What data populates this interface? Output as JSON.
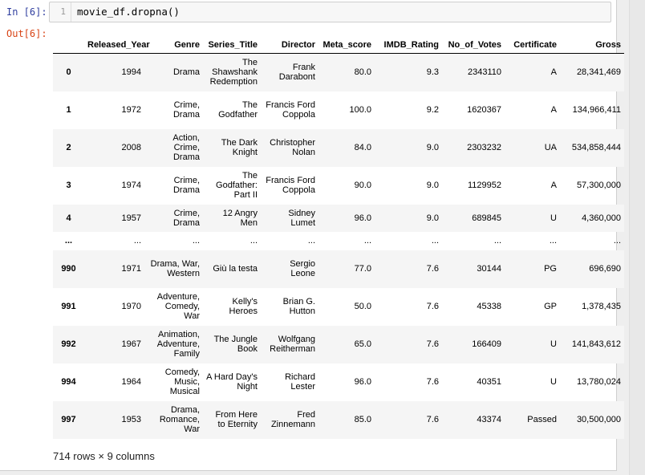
{
  "prompts": {
    "in": "In [6]:",
    "out": "Out[6]:"
  },
  "cell": {
    "line_number": "1",
    "code": "movie_df.dropna()"
  },
  "table": {
    "columns": [
      "Released_Year",
      "Genre",
      "Series_Title",
      "Director",
      "Meta_score",
      "IMDB_Rating",
      "No_of_Votes",
      "Certificate",
      "Gross"
    ],
    "rows": [
      {
        "index": "0",
        "cells": [
          "1994",
          "Drama",
          "The Shawshank Redemption",
          "Frank Darabont",
          "80.0",
          "9.3",
          "2343110",
          "A",
          "28,341,469"
        ]
      },
      {
        "index": "1",
        "cells": [
          "1972",
          "Crime, Drama",
          "The Godfather",
          "Francis Ford Coppola",
          "100.0",
          "9.2",
          "1620367",
          "A",
          "134,966,411"
        ]
      },
      {
        "index": "2",
        "cells": [
          "2008",
          "Action, Crime, Drama",
          "The Dark Knight",
          "Christopher Nolan",
          "84.0",
          "9.0",
          "2303232",
          "UA",
          "534,858,444"
        ]
      },
      {
        "index": "3",
        "cells": [
          "1974",
          "Crime, Drama",
          "The Godfather: Part II",
          "Francis Ford Coppola",
          "90.0",
          "9.0",
          "1129952",
          "A",
          "57,300,000"
        ]
      },
      {
        "index": "4",
        "cells": [
          "1957",
          "Crime, Drama",
          "12 Angry Men",
          "Sidney Lumet",
          "96.0",
          "9.0",
          "689845",
          "U",
          "4,360,000"
        ]
      },
      {
        "index": "...",
        "cells": [
          "...",
          "...",
          "...",
          "...",
          "...",
          "...",
          "...",
          "...",
          "..."
        ]
      },
      {
        "index": "990",
        "cells": [
          "1971",
          "Drama, War, Western",
          "Giù la testa",
          "Sergio Leone",
          "77.0",
          "7.6",
          "30144",
          "PG",
          "696,690"
        ]
      },
      {
        "index": "991",
        "cells": [
          "1970",
          "Adventure, Comedy, War",
          "Kelly's Heroes",
          "Brian G. Hutton",
          "50.0",
          "7.6",
          "45338",
          "GP",
          "1,378,435"
        ]
      },
      {
        "index": "992",
        "cells": [
          "1967",
          "Animation, Adventure, Family",
          "The Jungle Book",
          "Wolfgang Reitherman",
          "65.0",
          "7.6",
          "166409",
          "U",
          "141,843,612"
        ]
      },
      {
        "index": "994",
        "cells": [
          "1964",
          "Comedy, Music, Musical",
          "A Hard Day's Night",
          "Richard Lester",
          "96.0",
          "7.6",
          "40351",
          "U",
          "13,780,024"
        ]
      },
      {
        "index": "997",
        "cells": [
          "1953",
          "Drama, Romance, War",
          "From Here to Eternity",
          "Fred Zinnemann",
          "85.0",
          "7.6",
          "43374",
          "Passed",
          "30,500,000"
        ]
      }
    ]
  },
  "shape": "714 rows × 9 columns"
}
